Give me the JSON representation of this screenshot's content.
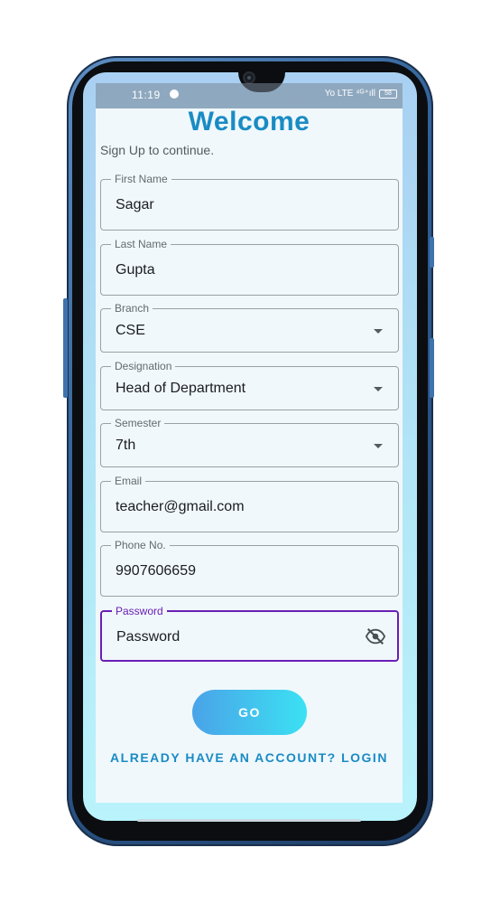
{
  "status_bar": {
    "time": "11:19",
    "signal_text": "Yo LTE ⁴ᴳ⁺ıll",
    "battery": "58"
  },
  "form": {
    "title": "Welcome",
    "subtitle": "Sign Up to continue.",
    "fields": [
      {
        "label": "First Name",
        "value": "Sagar"
      },
      {
        "label": "Last Name",
        "value": "Gupta"
      },
      {
        "label": "Branch",
        "value": "CSE"
      },
      {
        "label": "Designation",
        "value": "Head of Department"
      },
      {
        "label": "Semester",
        "value": "7th"
      },
      {
        "label": "Email",
        "value": "teacher@gmail.com"
      },
      {
        "label": "Phone No.",
        "value": "9907606659"
      },
      {
        "label": "Password",
        "value": "Password"
      }
    ],
    "go_label": "GO",
    "login_link": "ALREADY HAVE AN ACCOUNT? LOGIN"
  },
  "icons": {
    "password_toggle": "eye-off-icon",
    "dropdown": "chevron-down-icon"
  },
  "colors": {
    "accent": "#1a8bc4",
    "focus": "#6a1fb4",
    "button_gradient_start": "#4aa3e8",
    "button_gradient_end": "#3be1f3"
  }
}
